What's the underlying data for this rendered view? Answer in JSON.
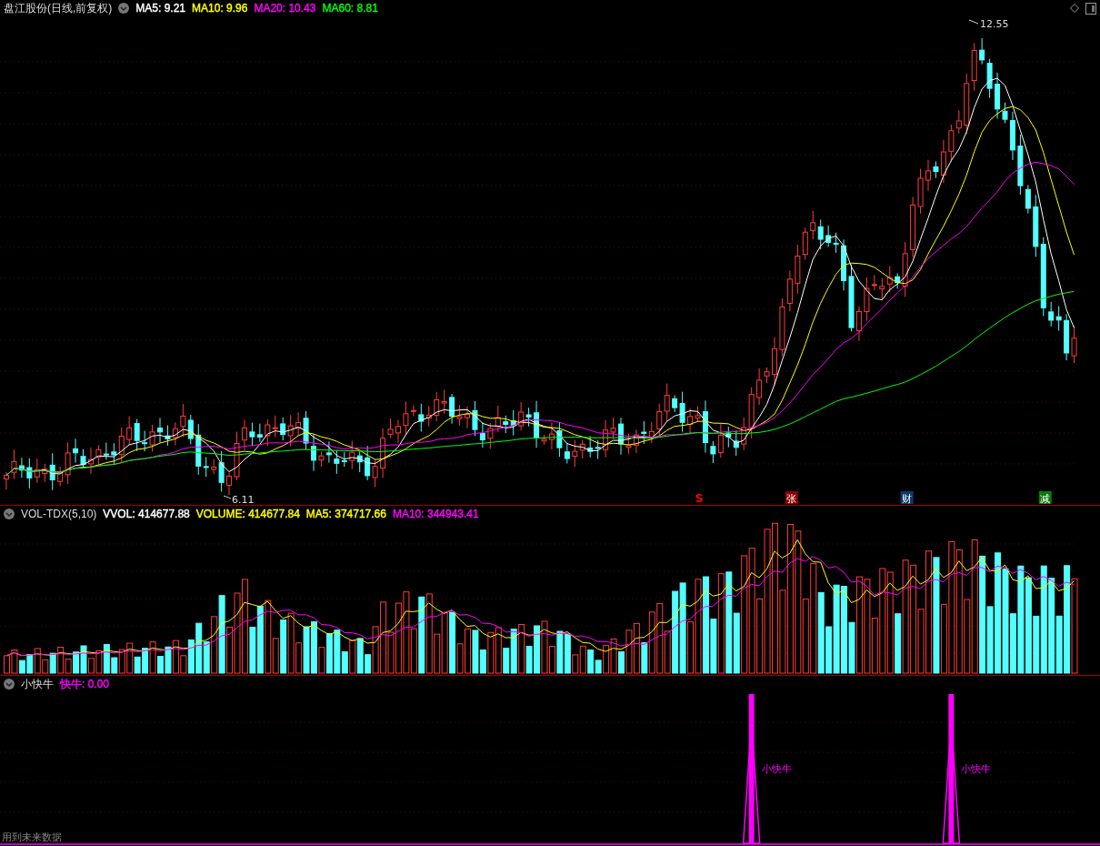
{
  "main_panel": {
    "title": "盘江股份(日线,前复权)",
    "indicators": [
      {
        "label": "MA5: 9.21",
        "color": "#ffffff"
      },
      {
        "label": "MA10: 9.96",
        "color": "#ffff00"
      },
      {
        "label": "MA20: 10.43",
        "color": "#ff00ff"
      },
      {
        "label": "MA60: 8.81",
        "color": "#00ff00"
      }
    ],
    "high_label": "12.55",
    "low_label": "6.11",
    "event_markers": [
      {
        "text": "S",
        "kind": "plain",
        "color": "#ff0000"
      },
      {
        "text": "张",
        "kind": "badge",
        "color": "#8b0000"
      },
      {
        "text": "财",
        "kind": "badge",
        "color": "#0a3a6e"
      },
      {
        "text": "减",
        "kind": "badge",
        "color": "#0a7a0a"
      }
    ]
  },
  "volume_panel": {
    "title": "VOL-TDX(5,10)",
    "indicators": [
      {
        "label": "VVOL: 414677.88",
        "color": "#ffffff"
      },
      {
        "label": "VOLUME: 414677.84",
        "color": "#ffff00"
      },
      {
        "label": "MA5: 374717.66",
        "color": "#ffff00"
      },
      {
        "label": "MA10: 344943.41",
        "color": "#ff00ff"
      }
    ]
  },
  "signal_panel": {
    "title": "小快牛",
    "indicators": [
      {
        "label": "快牛: 0.00",
        "color": "#ff00ff"
      }
    ],
    "signal_labels": [
      "小快牛",
      "小快牛"
    ],
    "note": "用到未来数据"
  }
}
